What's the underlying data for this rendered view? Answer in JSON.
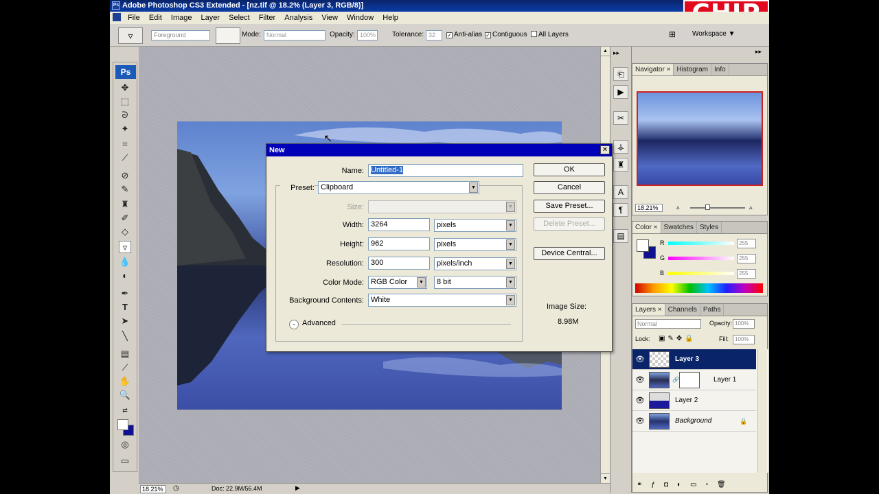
{
  "app": {
    "title": "Adobe Photoshop CS3 Extended - [nz.tif @ 18.2% (Layer 3, RGB/8)]",
    "logo": "CHIP"
  },
  "menu": [
    "File",
    "Edit",
    "Image",
    "Layer",
    "Select",
    "Filter",
    "Analysis",
    "View",
    "Window",
    "Help"
  ],
  "options": {
    "fill_source": "Foreground",
    "mode_label": "Mode:",
    "mode_value": "Normal",
    "opacity_label": "Opacity:",
    "opacity_value": "100%",
    "tolerance_label": "Tolerance:",
    "tolerance_value": "32",
    "antialias_label": "Anti-alias",
    "contiguous_label": "Contiguous",
    "all_layers_label": "All Layers",
    "workspace_label": "Workspace ▼"
  },
  "toolbox": {
    "logo": "Ps"
  },
  "status": {
    "zoom": "18.21%",
    "doc": "Doc: 22.9M/56.4M"
  },
  "navigator": {
    "tabs": [
      "Navigator",
      "Histogram",
      "Info"
    ],
    "zoom": "18.21%"
  },
  "color_panel": {
    "tabs": [
      "Color",
      "Swatches",
      "Styles"
    ],
    "channels": [
      {
        "label": "R",
        "value": "255"
      },
      {
        "label": "G",
        "value": "255"
      },
      {
        "label": "B",
        "value": "255"
      }
    ]
  },
  "layers_panel": {
    "tabs": [
      "Layers",
      "Channels",
      "Paths"
    ],
    "blend_mode": "Normal",
    "opacity_label": "Opacity:",
    "opacity_value": "100%",
    "lock_label": "Lock:",
    "fill_label": "Fill:",
    "fill_value": "100%",
    "layers": [
      {
        "name": "Layer 3",
        "selected": true
      },
      {
        "name": "Layer 1",
        "selected": false
      },
      {
        "name": "Layer 2",
        "selected": false
      },
      {
        "name": "Background",
        "selected": false
      }
    ]
  },
  "dialog": {
    "title": "New",
    "name_label": "Name:",
    "name_value": "Untitled-1",
    "preset_label": "Preset:",
    "preset_value": "Clipboard",
    "size_label": "Size:",
    "width_label": "Width:",
    "width_value": "3264",
    "width_unit": "pixels",
    "height_label": "Height:",
    "height_value": "962",
    "height_unit": "pixels",
    "resolution_label": "Resolution:",
    "resolution_value": "300",
    "resolution_unit": "pixels/inch",
    "colormode_label": "Color Mode:",
    "colormode_value": "RGB Color",
    "bitdepth_value": "8 bit",
    "background_label": "Background Contents:",
    "background_value": "White",
    "advanced_label": "Advanced",
    "ok_label": "OK",
    "cancel_label": "Cancel",
    "save_preset_label": "Save Preset...",
    "delete_preset_label": "Delete Preset...",
    "device_central_label": "Device Central...",
    "image_size_label": "Image Size:",
    "image_size_value": "8.98M"
  }
}
